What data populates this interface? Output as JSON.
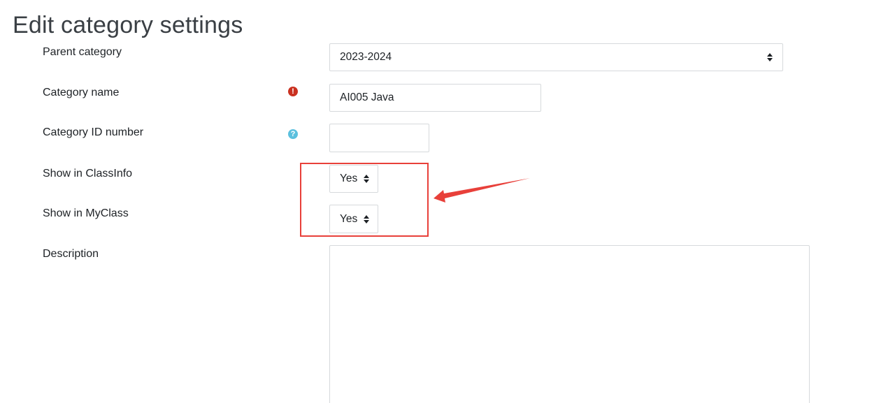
{
  "page": {
    "title": "Edit category settings"
  },
  "form": {
    "parent_category": {
      "label": "Parent category",
      "value": "2023-2024"
    },
    "category_name": {
      "label": "Category name",
      "value": "AI005 Java",
      "required_icon": "exclamation-circle-icon"
    },
    "category_id_number": {
      "label": "Category ID number",
      "value": "",
      "help_icon": "question-circle-icon"
    },
    "show_in_classinfo": {
      "label": "Show in ClassInfo",
      "value": "Yes"
    },
    "show_in_myclass": {
      "label": "Show in MyClass",
      "value": "Yes"
    },
    "description": {
      "label": "Description",
      "value": ""
    }
  },
  "annotation": {
    "color": "#e8403a"
  }
}
